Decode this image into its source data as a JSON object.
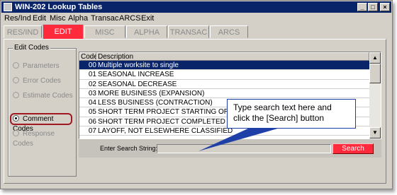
{
  "window": {
    "title": "WIN-202 Lookup Tables",
    "buttons": [
      "_",
      "□",
      "×"
    ]
  },
  "menu": [
    "Res/Ind",
    "Edit",
    "Misc",
    "Alpha",
    "Transac",
    "ARCS",
    "Exit"
  ],
  "tabs": [
    {
      "label": "RES/IND",
      "active": false
    },
    {
      "label": "EDIT",
      "active": true
    },
    {
      "label": "MISC",
      "active": false
    },
    {
      "label": "ALPHA",
      "active": false
    },
    {
      "label": "TRANSAC",
      "active": false
    },
    {
      "label": "ARCS",
      "active": false
    }
  ],
  "edit_codes": {
    "label": "Edit Codes",
    "options": [
      {
        "label": "Parameters",
        "selected": false
      },
      {
        "label": "Error Codes",
        "selected": false
      },
      {
        "label": "Estimate Codes",
        "selected": false
      },
      {
        "label": "Comment Codes",
        "selected": true
      },
      {
        "label": "Response Codes",
        "selected": false
      }
    ]
  },
  "list": {
    "headers": {
      "code": "Code",
      "description": "Description"
    },
    "rows": [
      {
        "code": "00",
        "desc": "Multiple worksite to single",
        "selected": true
      },
      {
        "code": "01",
        "desc": "SEASONAL INCREASE",
        "selected": false
      },
      {
        "code": "02",
        "desc": "SEASONAL DECREASE",
        "selected": false
      },
      {
        "code": "03",
        "desc": "MORE BUSINESS (EXPANSION)",
        "selected": false
      },
      {
        "code": "04",
        "desc": "LESS BUSINESS (CONTRACTION)",
        "selected": false
      },
      {
        "code": "05",
        "desc": "SHORT TERM PROJECT STARTING OR CONT",
        "selected": false
      },
      {
        "code": "06",
        "desc": "SHORT TERM PROJECT COMPLETED",
        "selected": false
      },
      {
        "code": "07",
        "desc": "LAYOFF, NOT ELSEWHERE CLASSIFIED",
        "selected": false
      }
    ]
  },
  "search": {
    "label": "Enter Search String:",
    "value": "",
    "button": "Search"
  },
  "callout": {
    "text": "Type search text here and click the [Search] button"
  },
  "colors": {
    "accent_red": "#ff2b3d",
    "selection_blue": "#0a246a",
    "highlight_border": "#a01820"
  }
}
